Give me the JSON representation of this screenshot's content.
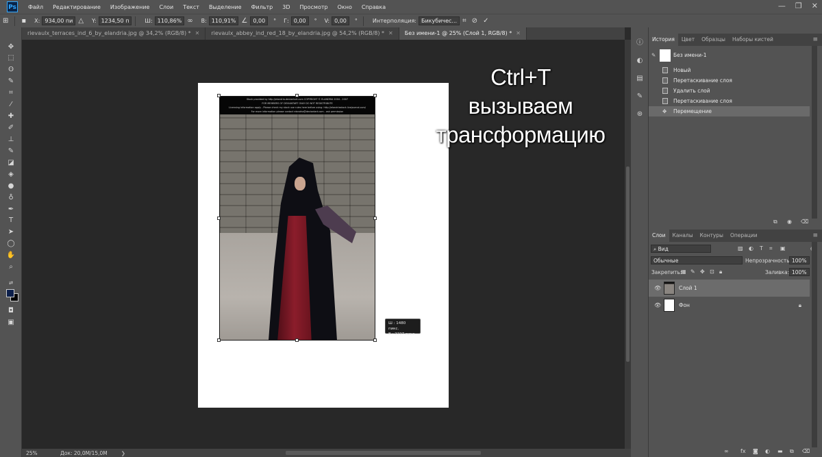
{
  "app": {
    "logo": "Ps"
  },
  "menu": [
    "Файл",
    "Редактирование",
    "Изображение",
    "Слои",
    "Текст",
    "Выделение",
    "Фильтр",
    "3D",
    "Просмотр",
    "Окно",
    "Справка"
  ],
  "window_controls": {
    "minimize": "—",
    "restore": "❐",
    "close": "✕"
  },
  "options": {
    "x_label": "X:",
    "x_value": "934,00 пи",
    "y_label": "Y:",
    "y_value": "1234,50 п",
    "w_label": "Ш:",
    "w_value": "110,86%",
    "h_label": "В:",
    "h_value": "110,91%",
    "angle_value": "0,00",
    "hskew_label": "Г:",
    "hskew_value": "0,00",
    "vskew_label": "V:",
    "vskew_value": "0,00",
    "interp_label": "Интерполяция:",
    "interp_value": "Бикубичес..."
  },
  "tabs": [
    {
      "label": "rievaulx_terraces_ind_6_by_elandria.jpg @ 34,2% (RGB/8) *"
    },
    {
      "label": "rievaulx_abbey_ind_red_18_by_elandria.jpg @ 54,2% (RGB/8) *"
    },
    {
      "label": "Без имени-1 @ 25% (Слой 1, RGB/8) *"
    }
  ],
  "photo_banner": {
    "line1": "Stock provided by http://elandria.deviantart.com  COPYRIGHT © ELANDRIA 2004 - 2007",
    "line2": "FOR MEMBERS OF DEVIANTART ONLY DO NOT REDISTRIBUTE",
    "line3": "Licensing information apply - Please check my stock use rules here before using: http://elandriastock.livejournal.com/",
    "line4": "For more information please contact elandria@deviantart.com - ask permission"
  },
  "overlay": {
    "line1": "Ctrl+T",
    "line2": "вызываем",
    "line3": "трансформацию"
  },
  "transform_tip": {
    "w": "Ш :  1480 пикс.",
    "h": "В :  2227 пикс."
  },
  "status": {
    "zoom": "25%",
    "doc": "Док: 20,0M/15,0M"
  },
  "history": {
    "tabs": [
      "История",
      "Цвет",
      "Образцы",
      "Наборы кистей"
    ],
    "snapshot": "Без имени-1",
    "items": [
      "Новый",
      "Перетаскивание слоя",
      "Удалить слой",
      "Перетаскивание слоя",
      "Перемещение"
    ]
  },
  "layers": {
    "tabs": [
      "Слои",
      "Каналы",
      "Контуры",
      "Операции"
    ],
    "filter_kind": "Вид",
    "blend_mode": "Обычные",
    "opacity_label": "Непрозрачность:",
    "opacity_value": "100%",
    "lock_label": "Закрепить:",
    "fill_label": "Заливка:",
    "fill_value": "100%",
    "items": [
      {
        "name": "Слой 1"
      },
      {
        "name": "Фон"
      }
    ]
  }
}
